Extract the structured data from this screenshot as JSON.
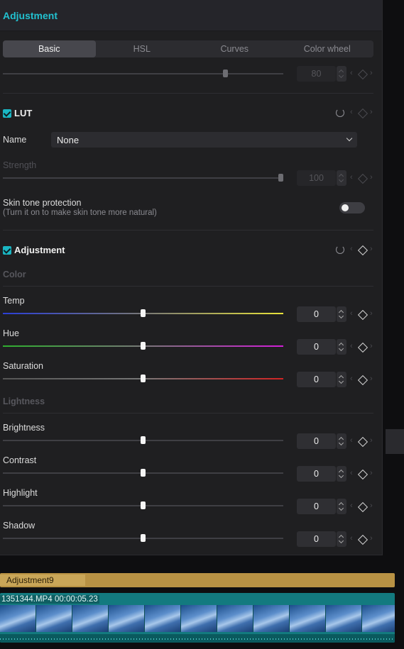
{
  "panel": {
    "title": "Adjustment"
  },
  "tabs": [
    {
      "label": "Basic",
      "active": true
    },
    {
      "label": "HSL",
      "active": false
    },
    {
      "label": "Curves",
      "active": false
    },
    {
      "label": "Color wheel",
      "active": false
    }
  ],
  "top_partial_slider": {
    "value": "80"
  },
  "lut": {
    "title": "LUT",
    "enabled": true,
    "name_label": "Name",
    "name_value": "None",
    "strength_label": "Strength",
    "strength_value": "100",
    "skin_label": "Skin tone protection",
    "skin_hint": "(Turn it on to make skin tone more natural)",
    "skin_enabled": false
  },
  "adjustment": {
    "title": "Adjustment",
    "enabled": true,
    "color_group": "Color",
    "lightness_group": "Lightness",
    "sliders": {
      "temp": {
        "label": "Temp",
        "value": "0"
      },
      "hue": {
        "label": "Hue",
        "value": "0"
      },
      "saturation": {
        "label": "Saturation",
        "value": "0"
      },
      "brightness": {
        "label": "Brightness",
        "value": "0"
      },
      "contrast": {
        "label": "Contrast",
        "value": "0"
      },
      "highlight": {
        "label": "Highlight",
        "value": "0"
      },
      "shadow": {
        "label": "Shadow",
        "value": "0"
      }
    }
  },
  "timeline": {
    "adjustment_clip": "Adjustment9",
    "video_clip_name": "1351344.MP4",
    "video_clip_duration": "00:00:05.23"
  },
  "colors": {
    "accent": "#22c1d0",
    "adjustment_clip": "#b89244",
    "video_clip": "#137a7f"
  }
}
